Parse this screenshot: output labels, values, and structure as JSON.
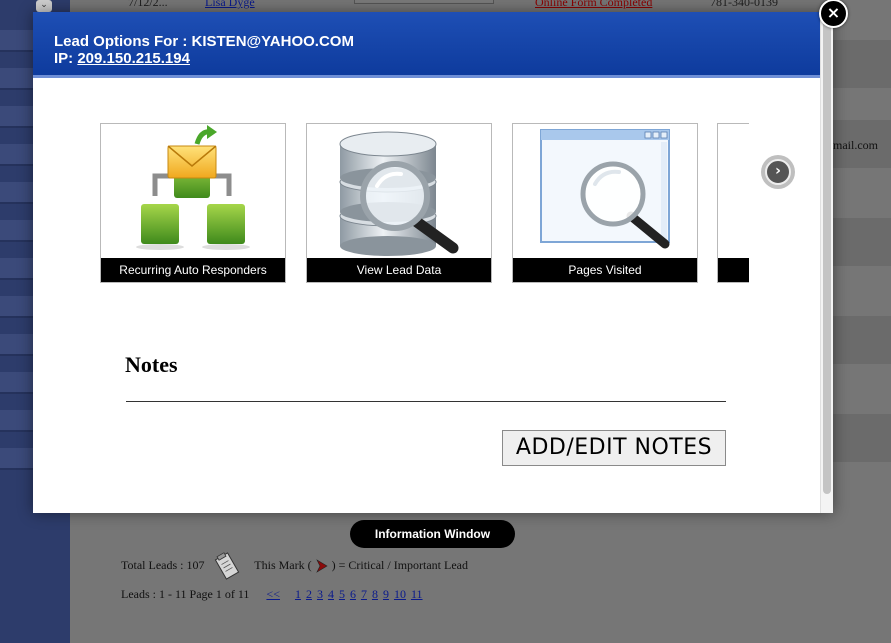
{
  "background": {
    "top_row": {
      "first_cell": "7/12/2...",
      "name_link": "Lisa Dyge",
      "status_link": "Online Form Completed",
      "phone": "781-340-0139"
    },
    "email_fragment": "mail.com",
    "info_window_label": "Information Window",
    "total_leads_label": "Total Leads : 107",
    "mark_label_prefix": "This Mark (",
    "mark_label_suffix": ") = Critical / Important Lead",
    "leads_range_label": "Leads : 1 - 11 Page 1 of 11",
    "pagination": {
      "prev": "<<",
      "pages": [
        "1",
        "2",
        "3",
        "4",
        "5",
        "6",
        "7",
        "8",
        "9",
        "10",
        "11"
      ]
    }
  },
  "modal": {
    "title_prefix": "Lead Options For :",
    "email": "KISTEN@YAHOO.COM",
    "ip_label": "IP:",
    "ip_value": "209.150.215.194",
    "close_glyph": "×",
    "options": [
      {
        "label": "Recurring Auto Responders",
        "icon": "auto-responder-icon"
      },
      {
        "label": "View Lead Data",
        "icon": "database-search-icon"
      },
      {
        "label": "Pages Visited",
        "icon": "window-search-icon"
      },
      {
        "label": "",
        "icon": "partially-hidden-option-icon"
      }
    ],
    "next_glyph": "›",
    "notes_title": "Notes",
    "notes_button": "ADD/EDIT NOTES"
  },
  "colors": {
    "header_blue": "#0d3a9c",
    "tile_caption_bg": "#000000",
    "overlay_gray": "#767676",
    "sidebar_navy": "#2d3c6b"
  }
}
